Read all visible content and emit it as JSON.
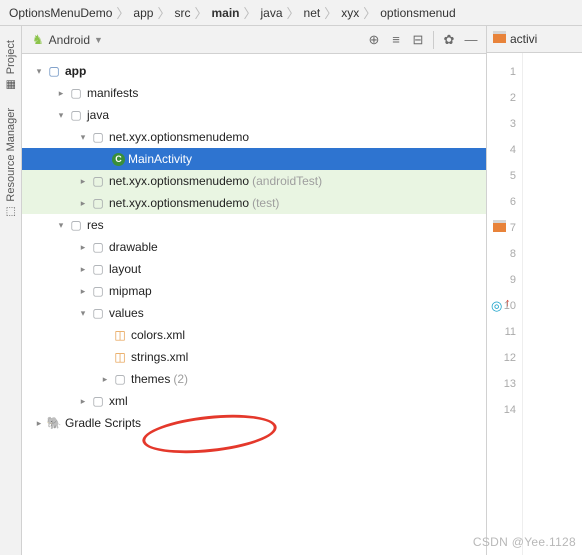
{
  "breadcrumb": [
    "OptionsMenuDemo",
    "app",
    "src",
    "main",
    "java",
    "net",
    "xyx",
    "optionsmenud"
  ],
  "breadcrumb_bold_index": 3,
  "sidebar": {
    "project": "Project",
    "resmgr": "Resource Manager"
  },
  "tree_header": {
    "title": "Android"
  },
  "tree": [
    {
      "d": 0,
      "tw": "down",
      "icon": "folder-mod",
      "label": "app",
      "bold": true
    },
    {
      "d": 1,
      "tw": "right",
      "icon": "folder",
      "label": "manifests"
    },
    {
      "d": 1,
      "tw": "down",
      "icon": "folder",
      "label": "java"
    },
    {
      "d": 2,
      "tw": "down",
      "icon": "pkg",
      "label": "net.xyx.optionsmenudemo"
    },
    {
      "d": 3,
      "tw": "",
      "icon": "cls",
      "label": "MainActivity",
      "selected": true
    },
    {
      "d": 2,
      "tw": "right",
      "icon": "pkg",
      "label": "net.xyx.optionsmenudemo",
      "dim": "(androidTest)",
      "scope": "test"
    },
    {
      "d": 2,
      "tw": "right",
      "icon": "pkg",
      "label": "net.xyx.optionsmenudemo",
      "dim": "(test)",
      "scope": "test"
    },
    {
      "d": 1,
      "tw": "down",
      "icon": "folder",
      "label": "res"
    },
    {
      "d": 2,
      "tw": "right",
      "icon": "folder",
      "label": "drawable"
    },
    {
      "d": 2,
      "tw": "right",
      "icon": "folder",
      "label": "layout"
    },
    {
      "d": 2,
      "tw": "right",
      "icon": "folder",
      "label": "mipmap"
    },
    {
      "d": 2,
      "tw": "down",
      "icon": "folder",
      "label": "values"
    },
    {
      "d": 3,
      "tw": "",
      "icon": "xml",
      "label": "colors.xml"
    },
    {
      "d": 3,
      "tw": "",
      "icon": "xml",
      "label": "strings.xml"
    },
    {
      "d": 3,
      "tw": "right",
      "icon": "folder",
      "label": "themes",
      "dim": "(2)"
    },
    {
      "d": 2,
      "tw": "right",
      "icon": "folder",
      "label": "xml"
    },
    {
      "d": 0,
      "tw": "right",
      "icon": "gradle",
      "label": "Gradle Scripts"
    }
  ],
  "editor": {
    "tab": "activi",
    "lines": [
      1,
      2,
      3,
      4,
      5,
      6,
      7,
      8,
      9,
      10,
      11,
      12,
      13,
      14
    ],
    "marks": {
      "7": "xml",
      "10": "target"
    }
  },
  "watermark": "CSDN @Yee.1128"
}
